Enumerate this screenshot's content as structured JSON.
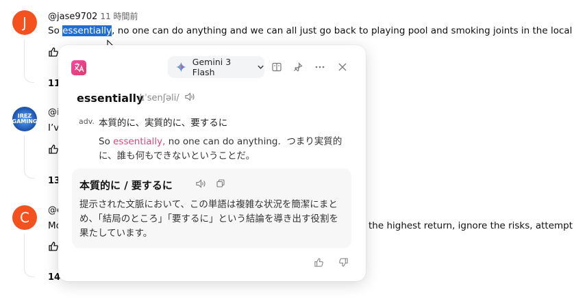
{
  "comments": [
    {
      "avatar_letter": "J",
      "avatar_color": "#f4511e",
      "handle": "@jase9702",
      "time": "11 時間前",
      "text_before": "So ",
      "text_highlight": "essentially",
      "text_after": ", no one can do anything and we can all just go back to playing pool and smoking joints in the local bar.",
      "likes": "11"
    },
    {
      "avatar_label": "IREZ GAMING",
      "handle": "@i",
      "text": "I’v",
      "likes": "13"
    },
    {
      "avatar_letter": "C",
      "avatar_color": "#f4511e",
      "handle": "@c",
      "text_left": "Mo",
      "text_right": "the highest return, ignore the risks, attempt to ca",
      "likes": "14"
    }
  ],
  "popup": {
    "model_name": "Gemini 3 Flash",
    "word": "essentially",
    "ipa": "/ɪˈsenʃəli/",
    "pos": "adv.",
    "meaning": "本質的に、実質的に、要するに",
    "example_prefix": "So ",
    "example_word": "essentially,",
    "example_rest": " no one can do anything.",
    "example_translation": "つまり実質的に、誰も何もできないということだ。",
    "card_title": "本質的に / 要するに",
    "card_text": "提示された文脈において、この単語は複雑な状況を簡潔にまとめ、「結局のところ」「要するに」という結論を導き出す役割を果たしています。"
  },
  "colors": {
    "accent_pink": "#e0457b",
    "highlight": "#1f6ed4"
  }
}
